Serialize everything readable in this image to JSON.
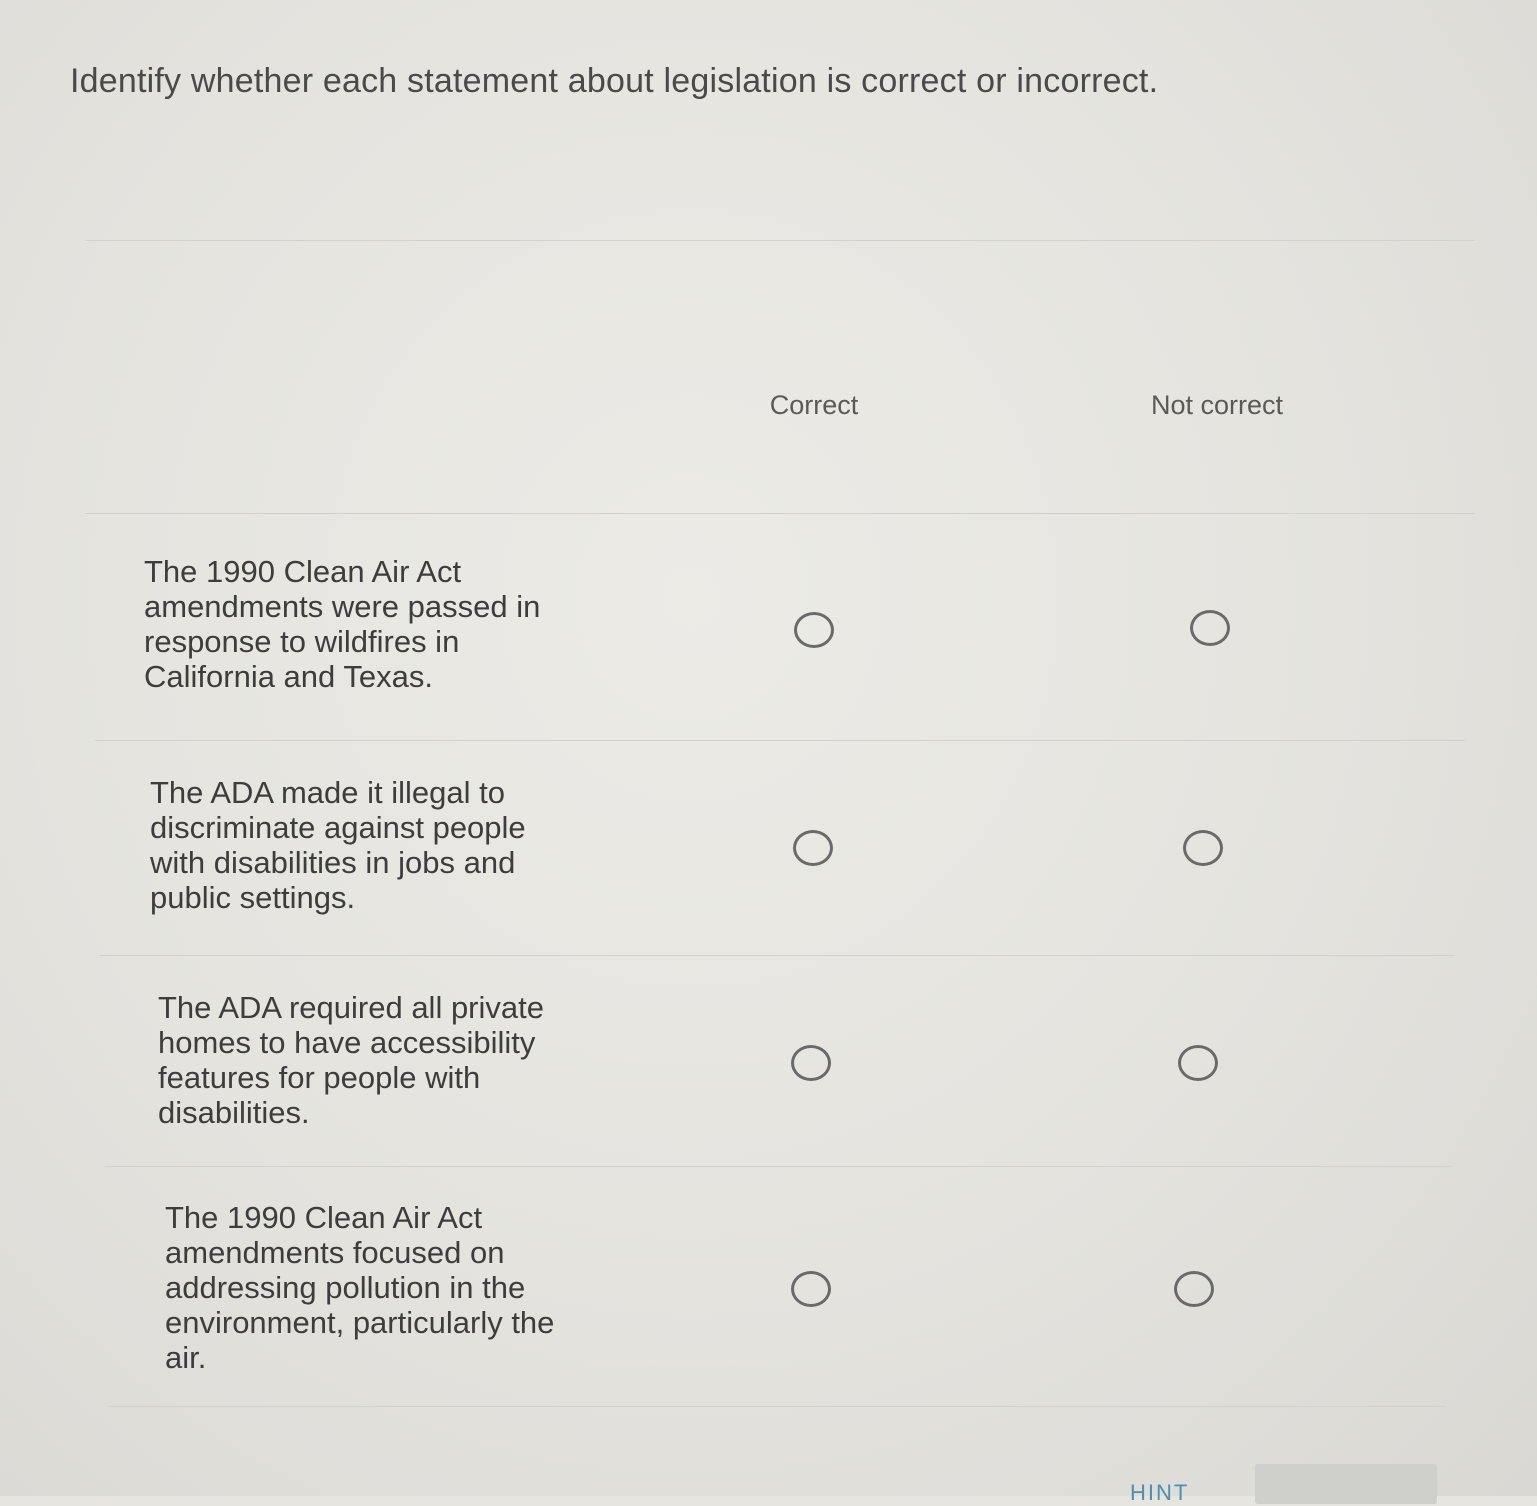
{
  "question": {
    "text": "Identify whether each statement about legislation is correct or incorrect."
  },
  "columns": {
    "correct": "Correct",
    "not_correct": "Not correct"
  },
  "statements": [
    {
      "text": "The 1990 Clean Air Act amendments were passed in response to wildfires in California and Texas."
    },
    {
      "text": "The ADA made it illegal to discriminate against people with disabilities in jobs and public settings."
    },
    {
      "text": "The ADA required all private homes to have accessibility features for people with disabilities."
    },
    {
      "text": "The 1990 Clean Air Act amendments focused on addressing pollution in the environment, particularly the air."
    }
  ],
  "footer": {
    "hint_label": "HINT"
  }
}
